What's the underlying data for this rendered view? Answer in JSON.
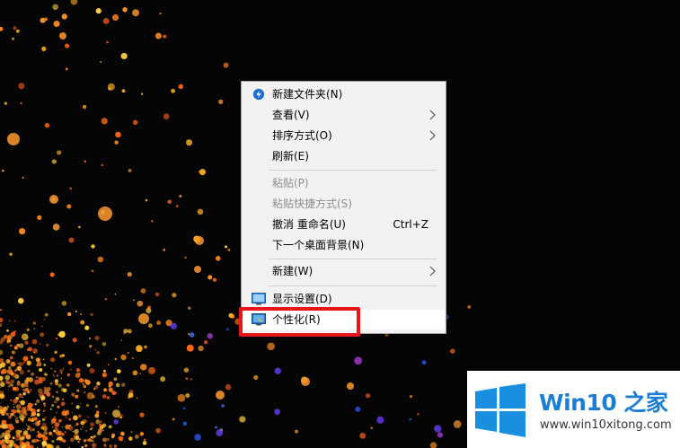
{
  "context_menu": {
    "items": [
      {
        "label": "新建文件夹(N)",
        "icon": "new-folder-icon"
      },
      {
        "label": "查看(V)",
        "submenu": true
      },
      {
        "label": "排序方式(O)",
        "submenu": true
      },
      {
        "label": "刷新(E)"
      },
      {
        "label": "粘贴(P)",
        "disabled": true
      },
      {
        "label": "粘贴快捷方式(S)",
        "disabled": true
      },
      {
        "label": "撤消 重命名(U)",
        "shortcut": "Ctrl+Z"
      },
      {
        "label": "下一个桌面背景(N)"
      },
      {
        "label": "新建(W)",
        "submenu": true
      },
      {
        "label": "显示设置(D)",
        "icon": "display-icon"
      },
      {
        "label": "个性化(R)",
        "icon": "personalize-icon",
        "highlighted": true
      }
    ]
  },
  "annotation": {
    "color": "#e8161b"
  },
  "watermark": {
    "title": "Win10 之家",
    "url": "www.win10xitong.com",
    "logo": "windows-logo-icon"
  }
}
